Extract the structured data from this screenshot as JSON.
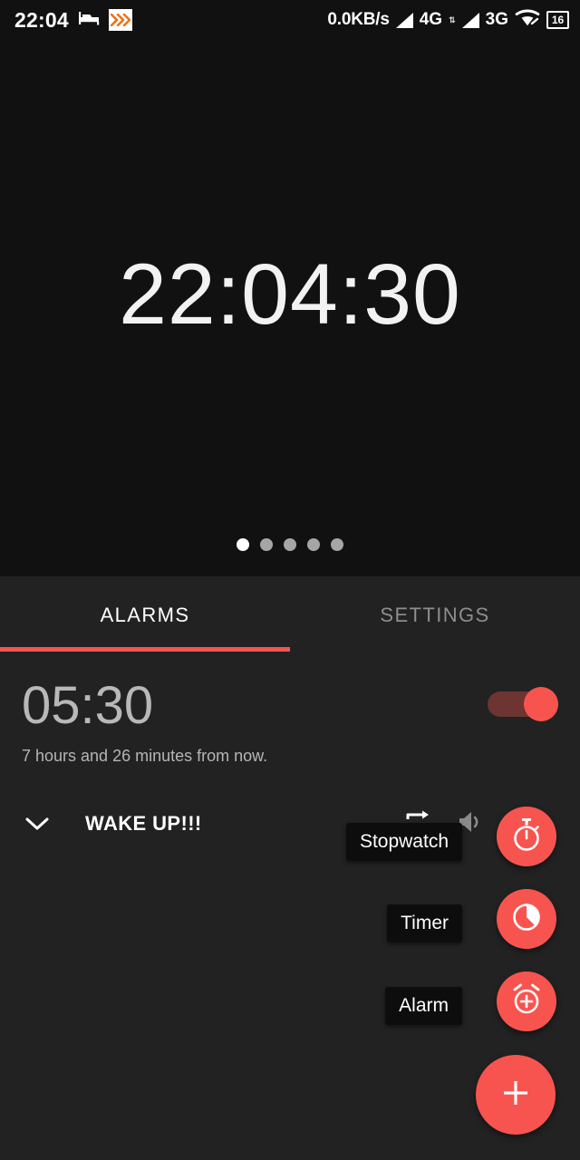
{
  "status_bar": {
    "clock": "22:04",
    "sleep_icon": "bed-icon",
    "fast_forward_badge": "»›",
    "network_speed": "0.0KB/s",
    "signal_1": "4G",
    "signal_1_sub": "⇅",
    "signal_2": "3G",
    "wifi_icon": "wifi-icon",
    "battery_level": "16"
  },
  "clock_pane": {
    "time": "22:04:30",
    "page_dots": {
      "total": 5,
      "active_index": 0
    }
  },
  "tabs": [
    {
      "label": "ALARMS",
      "active": true
    },
    {
      "label": "SETTINGS",
      "active": false
    }
  ],
  "alarm": {
    "time": "05:30",
    "subtitle": "7 hours and 26 minutes from now.",
    "enabled": true,
    "label": "WAKE UP!!!",
    "expand_icon": "chevron-down-icon",
    "row_icons": [
      "repeat-icon",
      "volume-up-icon",
      "vibration-icon"
    ]
  },
  "fab_menu": {
    "items": [
      {
        "tooltip": "Stopwatch",
        "icon": "stopwatch-icon"
      },
      {
        "tooltip": "Timer",
        "icon": "timer-icon"
      },
      {
        "tooltip": "Alarm",
        "icon": "alarm-add-icon"
      }
    ],
    "main": {
      "icon": "plus-icon"
    }
  },
  "colors": {
    "accent": "#f8544f",
    "background": "#222222",
    "clock_background": "#111111",
    "toggle_track": "#6d3431",
    "tooltip_background": "#0d0d0d"
  }
}
